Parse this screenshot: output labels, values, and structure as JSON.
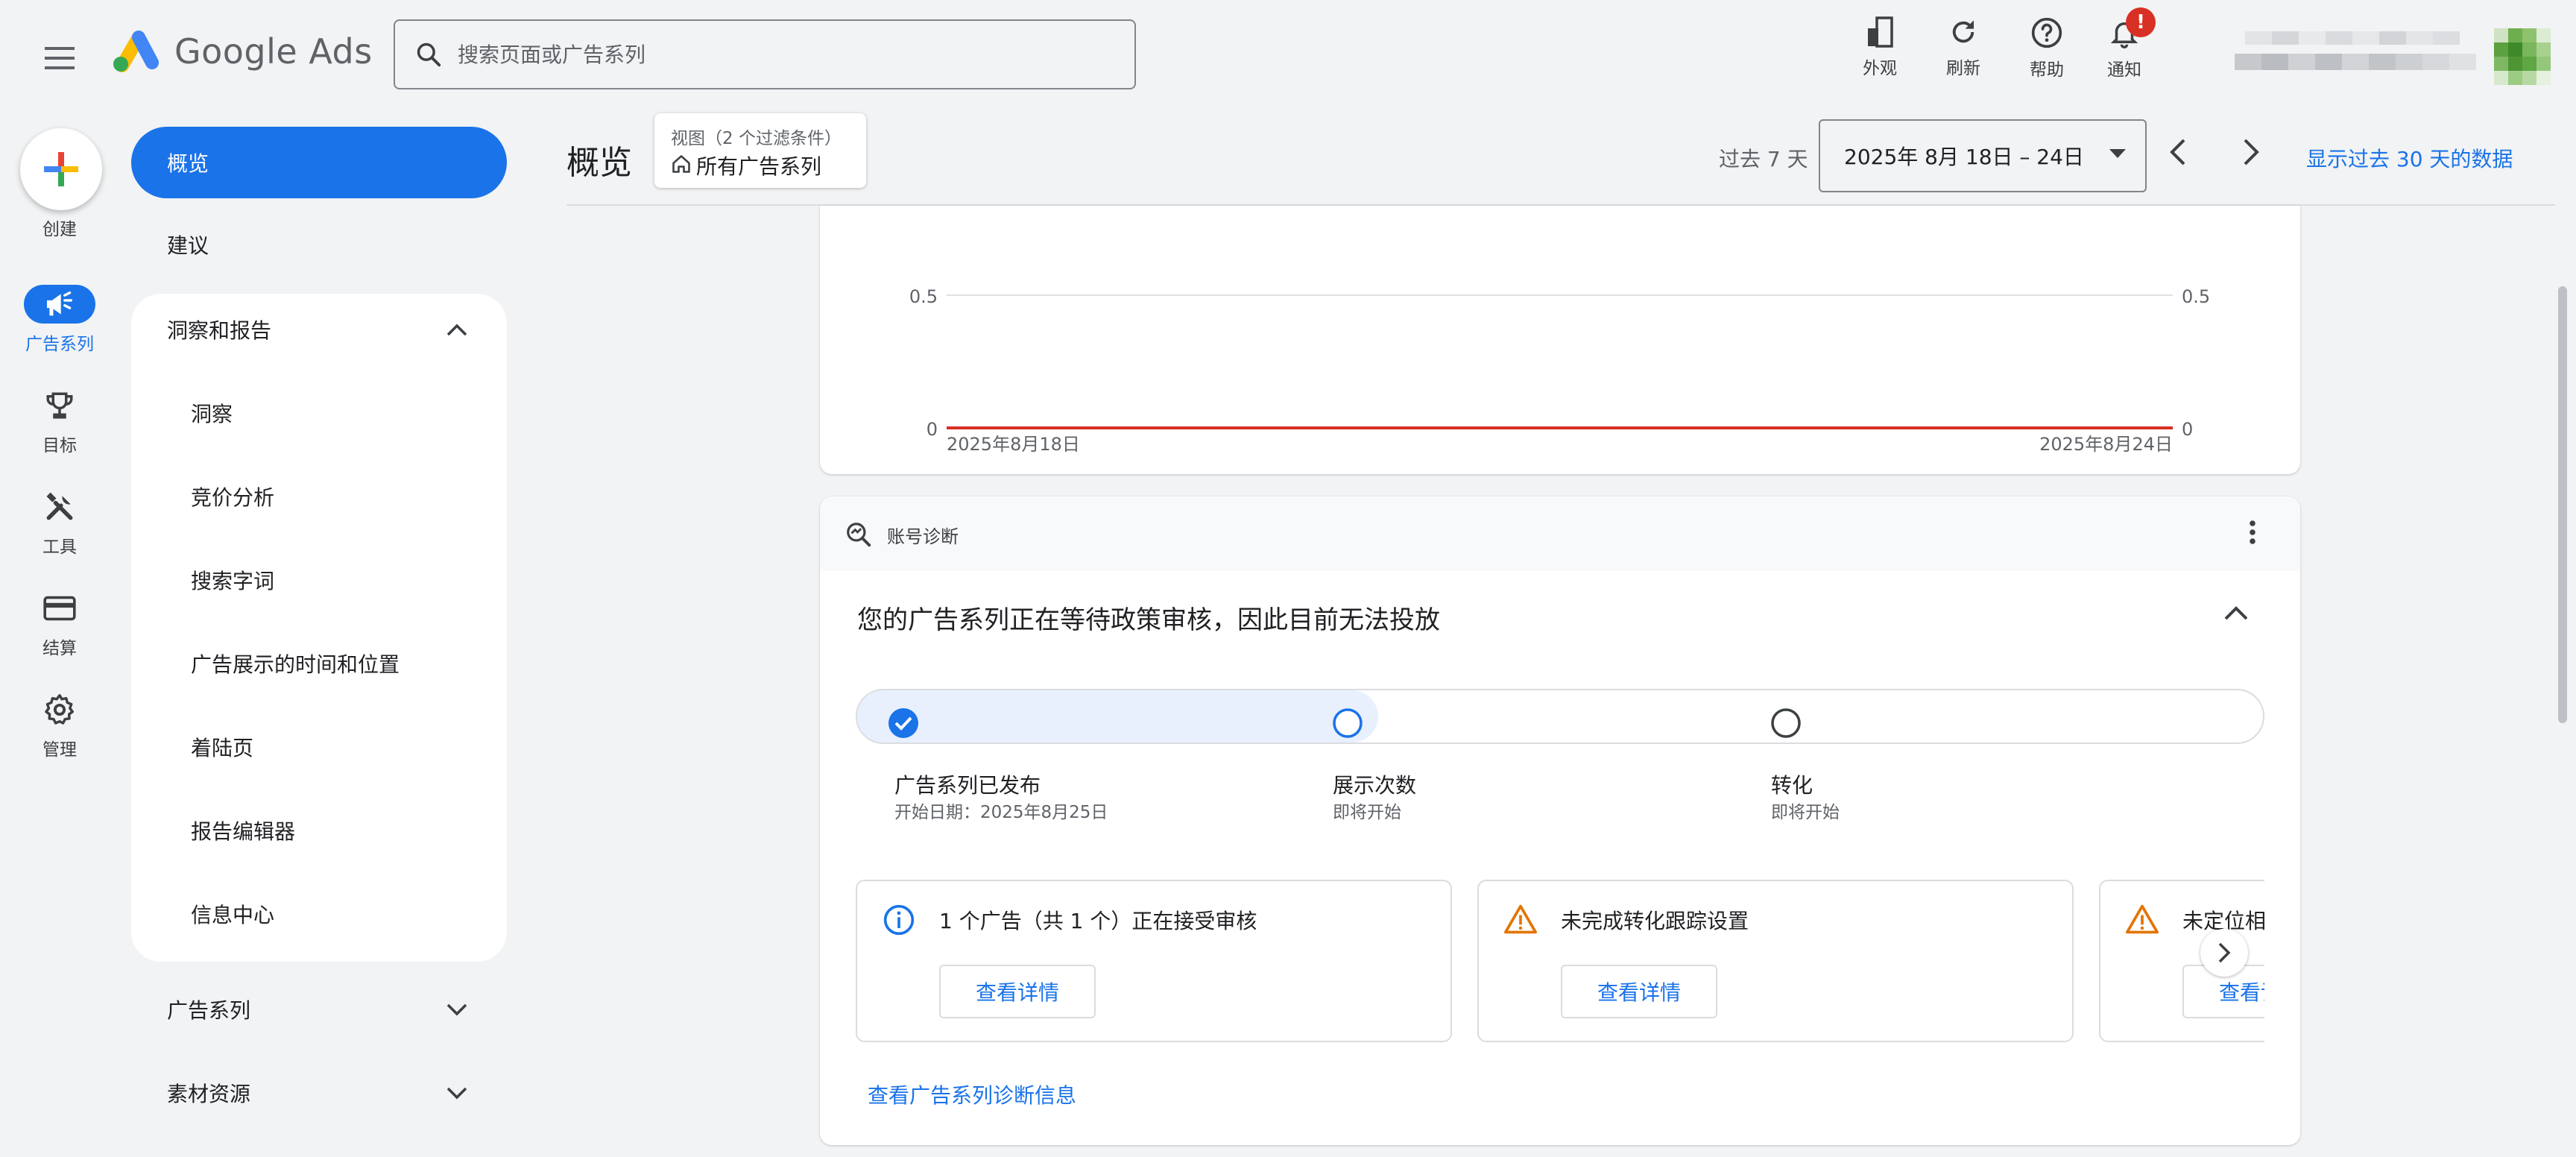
{
  "app": {
    "name": "Google Ads"
  },
  "search": {
    "placeholder": "搜索页面或广告系列"
  },
  "toolbar": {
    "appearance": "外观",
    "refresh": "刷新",
    "help": "帮助",
    "notifications": "通知",
    "notification_badge": "!"
  },
  "rail": {
    "create": "创建",
    "campaigns": "广告系列",
    "goals": "目标",
    "tools": "工具",
    "billing": "结算",
    "admin": "管理"
  },
  "nav": {
    "overview": "概览",
    "recommendations": "建议",
    "insights_reports": "洞察和报告",
    "sub_items": [
      "洞察",
      "竞价分析",
      "搜索字词",
      "广告展示的时间和位置",
      "着陆页",
      "报告编辑器",
      "信息中心"
    ],
    "campaigns": "广告系列",
    "assets": "素材资源"
  },
  "header": {
    "title": "概览",
    "view_label": "视图（2 个过滤条件）",
    "view_value": "所有广告系列",
    "range_label": "过去 7 天",
    "date_range": "2025年 8月 18日 – 24日",
    "show_30_days": "显示过去 30 天的数据"
  },
  "chart_data": {
    "type": "line",
    "x": [
      "2025年8月18日",
      "2025年8月24日"
    ],
    "series": [
      {
        "values": [
          0,
          0
        ]
      }
    ],
    "y_ticks": [
      "0",
      "0.5"
    ],
    "y2_ticks": [
      "0",
      "0.5"
    ],
    "ylim": [
      0,
      0.5
    ],
    "line_color": "#d93025",
    "grid": true
  },
  "diagnostics": {
    "header": "账号诊断",
    "title": "您的广告系列正在等待政策审核，因此目前无法投放",
    "progress": 0.37,
    "steps": [
      {
        "title": "广告系列已发布",
        "sub": "开始日期：2025年8月25日",
        "status": "done"
      },
      {
        "title": "展示次数",
        "sub": "即将开始",
        "status": "current"
      },
      {
        "title": "转化",
        "sub": "即将开始",
        "status": "pending"
      }
    ],
    "issues": [
      {
        "title": "1 个广告（共 1 个）正在接受审核",
        "button": "查看详情",
        "icon": "info-icon"
      },
      {
        "title": "未完成转化跟踪设置",
        "button": "查看详情",
        "icon": "warning-icon"
      },
      {
        "title": "未定位相",
        "button": "查看详情",
        "icon": "warning-icon"
      }
    ],
    "link": "查看广告系列诊断信息"
  },
  "colors": {
    "primary": "#1a73e8",
    "background": "#f1f3f4",
    "warning": "#e37400",
    "error": "#d93025"
  }
}
